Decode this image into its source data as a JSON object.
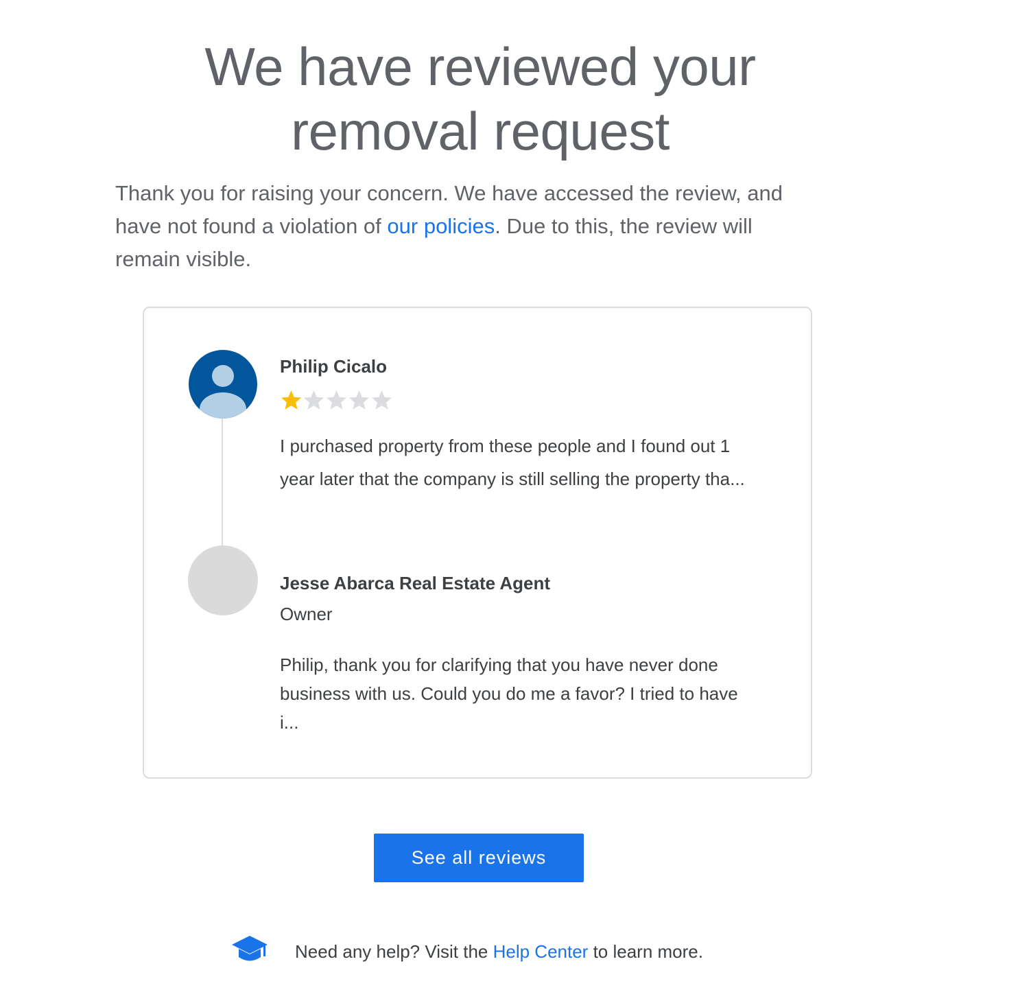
{
  "header": {
    "title": "We have reviewed your removal request"
  },
  "intro": {
    "text_before_link": "Thank you for raising your concern. We have accessed the review, and have not found a violation of ",
    "link_text": "our policies",
    "text_after_link": ". Due to this, the review will remain visible."
  },
  "review": {
    "reviewer": {
      "name": "Philip Cicalo",
      "avatar_icon": "person-avatar-icon",
      "avatar_color": "#02569b",
      "rating": 1,
      "max_rating": 5,
      "text": "I purchased property from these people and I found out 1 year later that the company is still selling the property tha..."
    },
    "owner_reply": {
      "name": "Jesse Abarca Real Estate Agent",
      "role": "Owner",
      "text": "Philip, thank you for clarifying that you have never done business with us. Could you do me a favor? I tried to have i..."
    }
  },
  "cta": {
    "label": "See all reviews"
  },
  "help": {
    "icon": "graduation-cap-icon",
    "text_before_link": "Need any help? Visit the ",
    "link_text": "Help Center",
    "text_after_link": " to learn more."
  },
  "colors": {
    "accent": "#1a73e8",
    "star_filled": "#fbbc04",
    "star_empty": "#dadce0",
    "text": "#5f6368",
    "border": "#dadce0"
  }
}
